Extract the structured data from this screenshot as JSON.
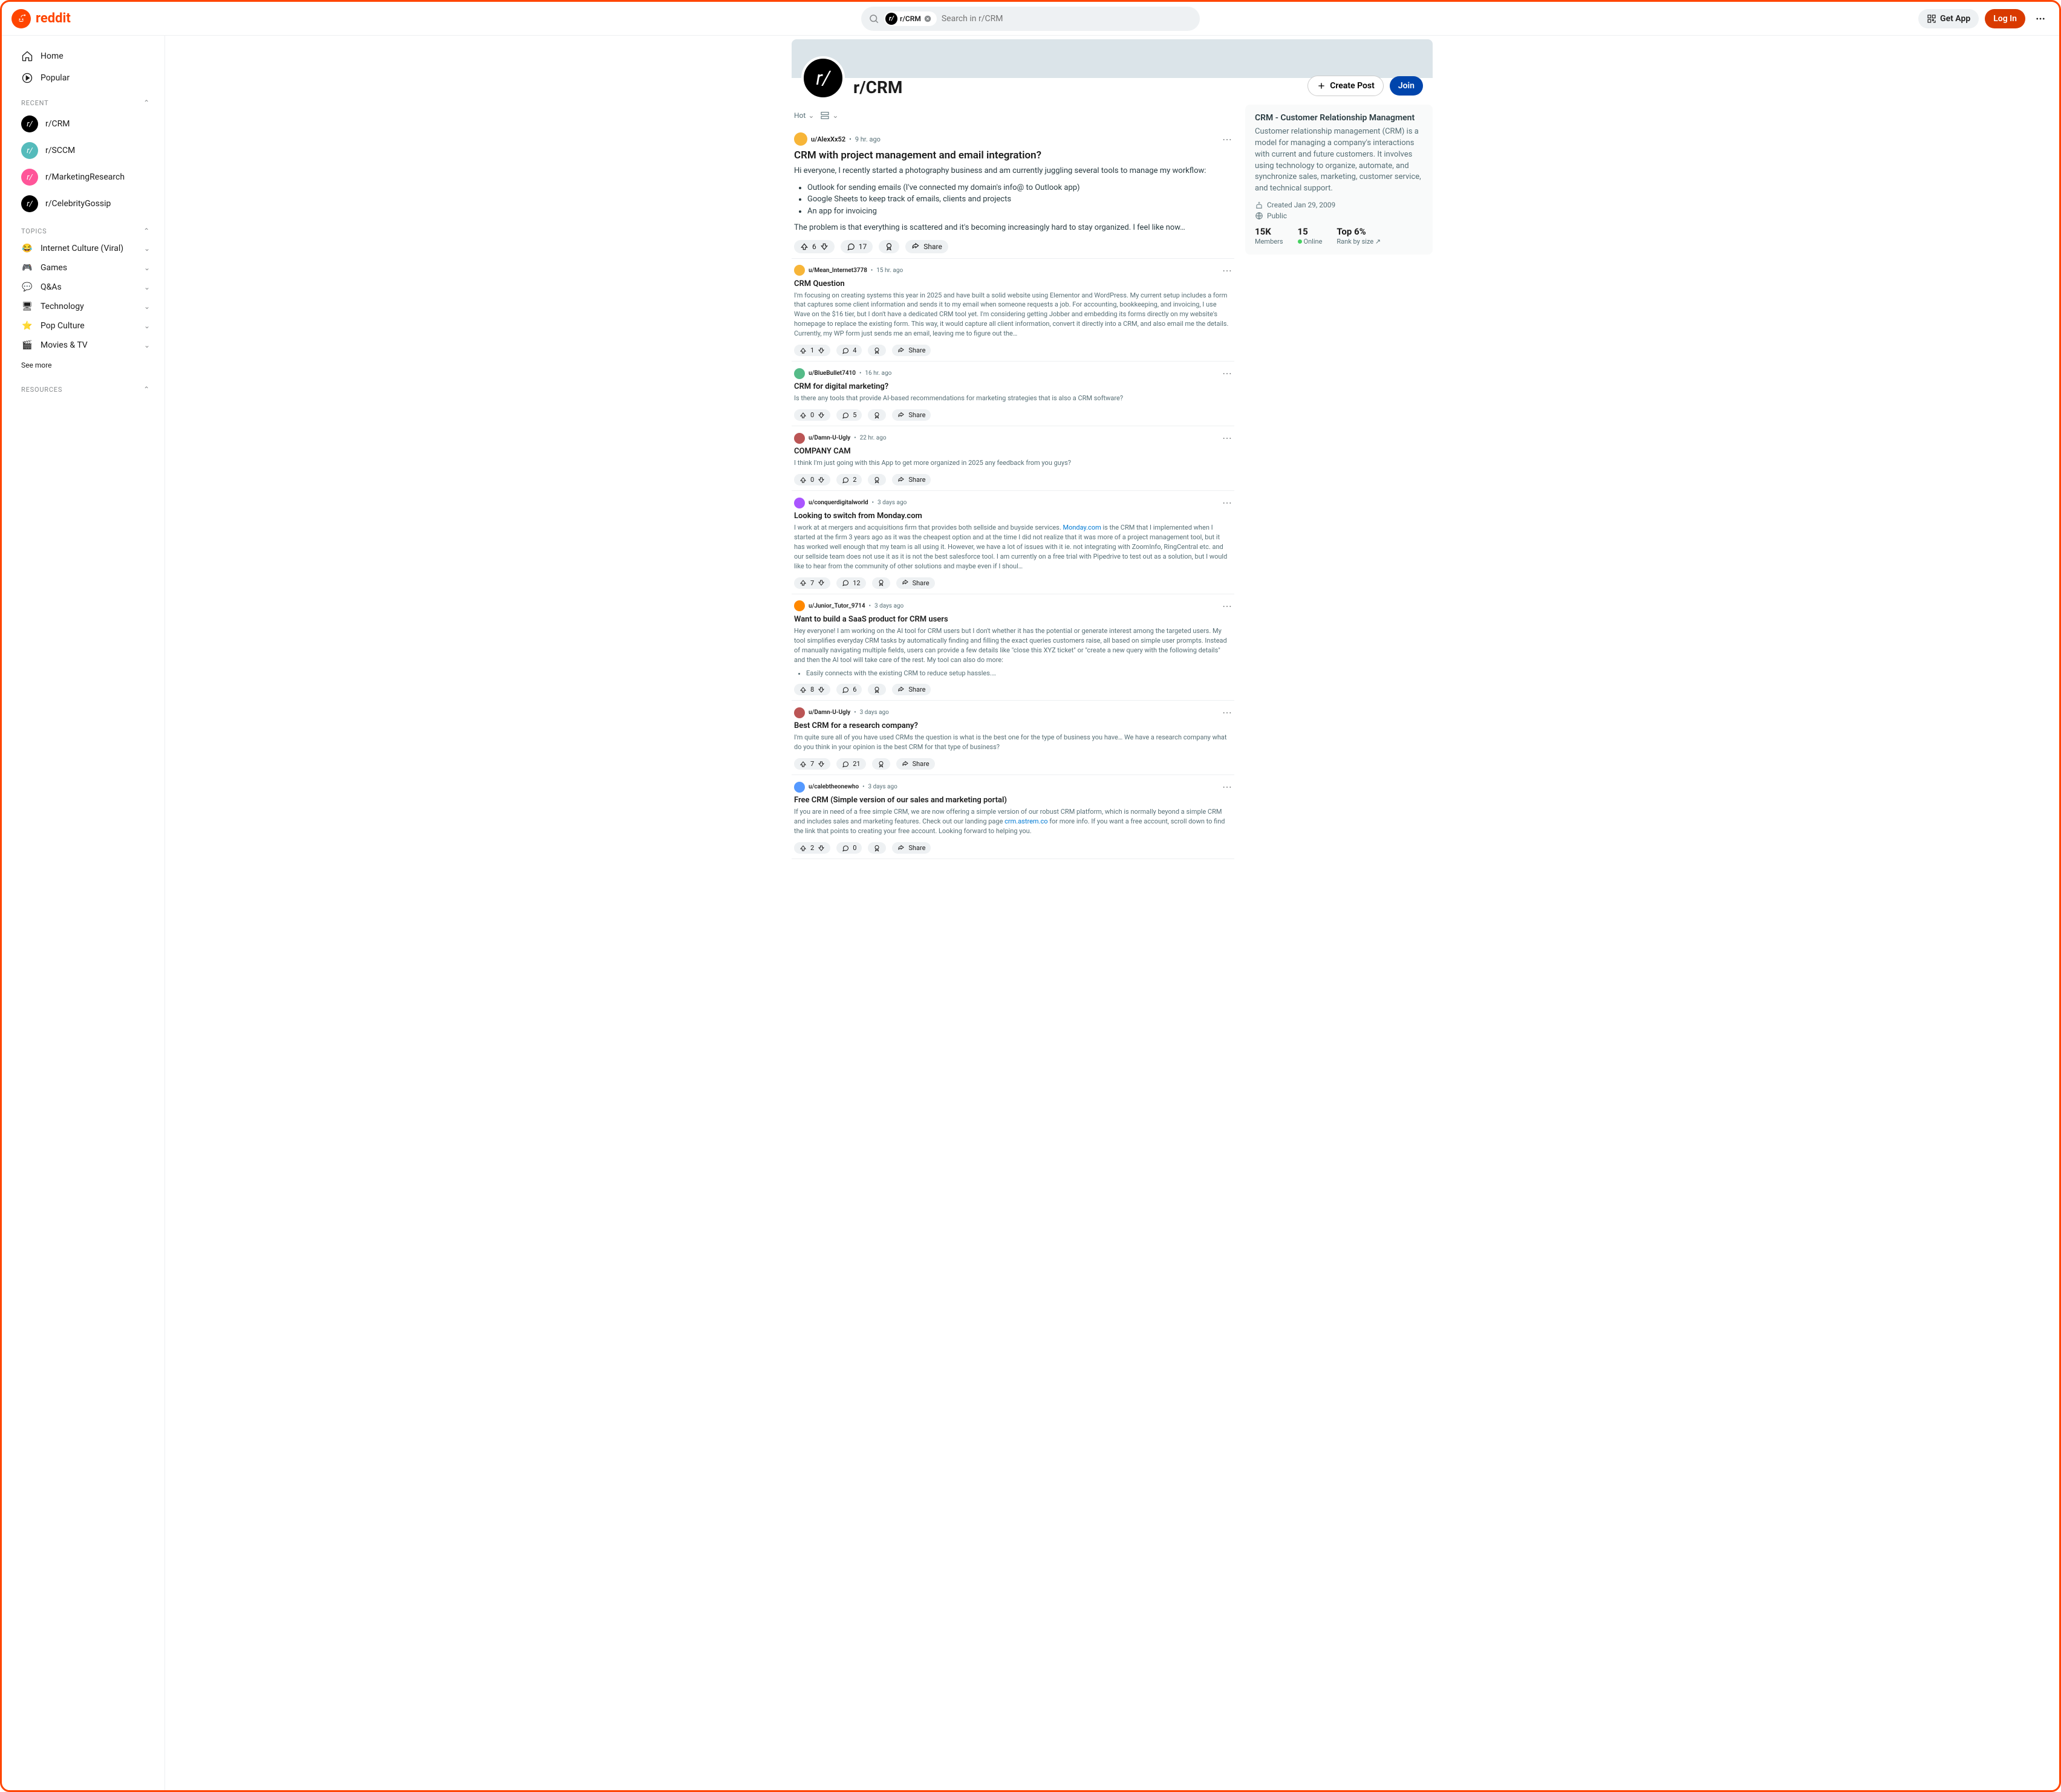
{
  "header": {
    "logo_text": "reddit",
    "search_chip": "r/CRM",
    "search_placeholder": "Search in r/CRM",
    "get_app": "Get App",
    "log_in": "Log In"
  },
  "sidebar": {
    "home": "Home",
    "popular": "Popular",
    "recent_label": "RECENT",
    "recent": [
      "r/CRM",
      "r/SCCM",
      "r/MarketingResearch",
      "r/CelebrityGossip"
    ],
    "topics_label": "TOPICS",
    "topics": [
      "Internet Culture (Viral)",
      "Games",
      "Q&As",
      "Technology",
      "Pop Culture",
      "Movies & TV"
    ],
    "see_more": "See more",
    "resources_label": "RESOURCES"
  },
  "sub": {
    "name": "r/CRM",
    "create_post": "Create Post",
    "join": "Join",
    "sort": "Hot"
  },
  "aside": {
    "title": "CRM - Customer Relationship Managment",
    "desc": "Customer relationship management (CRM) is a model for managing a company's interactions with current and future customers. It involves using technology to organize, automate, and synchronize sales, marketing, customer service, and technical support.",
    "created": "Created Jan 29, 2009",
    "public": "Public",
    "members_n": "15K",
    "members_l": "Members",
    "online_n": "15",
    "online_l": "Online",
    "rank_n": "Top 6%",
    "rank_l": "Rank by size"
  },
  "featured": {
    "author": "u/AlexXx52",
    "time": "9 hr. ago",
    "title": "CRM with project management and email integration?",
    "intro": "Hi everyone, I recently started a photography business and am currently juggling several tools to manage my workflow:",
    "bullets": [
      "Outlook for sending emails (I've connected my domain's info@ to Outlook app)",
      "Google Sheets to keep track of emails, clients and projects",
      "An app for invoicing"
    ],
    "outro": "The problem is that everything is scattered and it's becoming increasingly hard to stay organized. I feel like now…",
    "votes": "6",
    "comments": "17",
    "share": "Share"
  },
  "posts": [
    {
      "author": "u/Mean_Internet3778",
      "time": "15 hr. ago",
      "title": "CRM Question",
      "body": "I'm focusing on creating systems this year in 2025 and have built a solid website using Elementor and WordPress. My current setup includes a form that captures some client information and sends it to my email when someone requests a job. For accounting, bookkeeping, and invoicing, I use Wave on the $16 tier, but I don't have a dedicated CRM tool yet. I'm considering getting Jobber and embedding its forms directly on my website's homepage to replace the existing form. This way, it would capture all client information, convert it directly into a CRM, and also email me the details. Currently, my WP form just sends me an email, leaving me to figure out the…",
      "votes": "1",
      "comments": "4",
      "share": "Share"
    },
    {
      "author": "u/BlueBullet7410",
      "time": "16 hr. ago",
      "title": "CRM for digital marketing?",
      "body": "Is there any tools that provide AI-based recommendations for marketing strategies that is also a CRM software?",
      "votes": "0",
      "comments": "5",
      "share": "Share"
    },
    {
      "author": "u/Damn-U-Ugly",
      "time": "22 hr. ago",
      "title": "COMPANY CAM",
      "body": "I think I'm just going with this App to get more organized in 2025 any feedback from you guys?",
      "votes": "0",
      "comments": "2",
      "share": "Share"
    },
    {
      "author": "u/conquerdigitalworld",
      "time": "3 days ago",
      "title": "Looking to switch from Monday.com",
      "body_pre": "I work at at mergers and acquisitions firm that provides both sellside and buyside services. ",
      "body_link": "Monday.com",
      "body_post": " is the CRM that I implemented when I started at the firm 3 years ago as it was the cheapest option and at the time I did not realize that it was more of a project management tool, but it has worked well enough that my team is all using it. However, we have a lot of issues with it ie. not integrating with ZoomInfo, RingCentral etc. and our sellside team does not use it as it is not the best salesforce tool. I am currently on a free trial with Pipedrive to test out as a solution, but I would like to hear from the community of other solutions and maybe even if I shoul…",
      "votes": "7",
      "comments": "12",
      "share": "Share"
    },
    {
      "author": "u/Junior_Tutor_9714",
      "time": "3 days ago",
      "title": "Want to build a SaaS product for CRM users",
      "body": "Hey everyone! I am working on the AI tool for CRM users but I don't whether it has the potential or generate interest among the targeted users. My tool simplifies everyday CRM tasks by automatically finding and filling the exact queries customers raise, all based on simple user prompts. Instead of manually navigating multiple fields, users can provide a few details like \"close this XYZ ticket\" or \"create a new query with the following details\" and then the AI tool will take care of the rest. My tool can also do more:",
      "bullets": [
        "Easily connects with the existing CRM to reduce setup hassles.…"
      ],
      "votes": "8",
      "comments": "6",
      "share": "Share"
    },
    {
      "author": "u/Damn-U-Ugly",
      "time": "3 days ago",
      "title": "Best CRM for a research company?",
      "body": "I'm quite sure all of you have used CRMs the question is what is the best one for the type of business you have… We have a research company what do you think in your opinion is the best CRM for that type of business?",
      "votes": "7",
      "comments": "21",
      "share": "Share"
    },
    {
      "author": "u/calebtheonewho",
      "time": "3 days ago",
      "title": "Free CRM (Simple version of our sales and marketing portal)",
      "body_pre": "If you are in need of a free simple CRM, we are now offering a simple version of our robust CRM platform, which is normally beyond a simple CRM and includes sales and marketing features. Check out our landing page ",
      "body_link": "crm.astrem.co",
      "body_post": " for more info. If you want a free account, scroll down to find the link that points to creating your free account. Looking forward to helping you.",
      "votes": "2",
      "comments": "0",
      "share": "Share"
    }
  ]
}
